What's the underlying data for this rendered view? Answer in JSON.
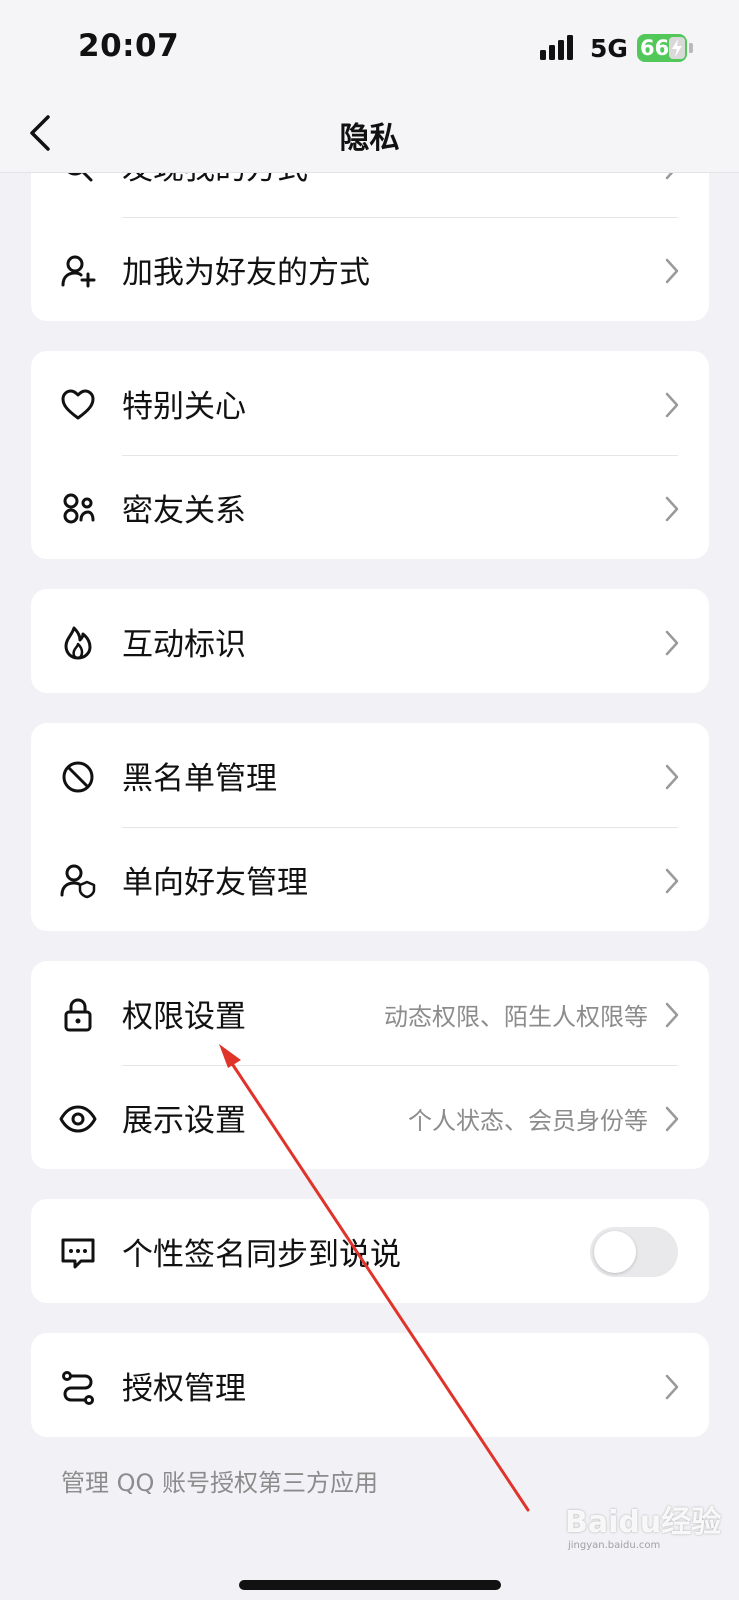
{
  "status_bar": {
    "time": "20:07",
    "network": "5G",
    "battery": "66"
  },
  "nav": {
    "title": "隐私"
  },
  "sections": {
    "discover": {
      "label": "发现我的方式"
    },
    "add_friend": {
      "label": "加我为好友的方式"
    },
    "special_care": {
      "label": "特别关心"
    },
    "close_friends": {
      "label": "密友关系"
    },
    "interaction": {
      "label": "互动标识"
    },
    "blacklist": {
      "label": "黑名单管理"
    },
    "one_way": {
      "label": "单向好友管理"
    },
    "permissions": {
      "label": "权限设置",
      "sub": "动态权限、陌生人权限等"
    },
    "display": {
      "label": "展示设置",
      "sub": "个人状态、会员身份等"
    },
    "signature_sync": {
      "label": "个性签名同步到说说",
      "enabled": false
    },
    "authorization": {
      "label": "授权管理"
    }
  },
  "footnote": "管理 QQ 账号授权第三方应用",
  "watermark": {
    "text": "Baidu经验",
    "sub": "jingyan.baidu.com"
  },
  "colors": {
    "background": "#f2f2f6",
    "card": "#ffffff",
    "secondary_text": "#8c8c8c",
    "battery": "#53c85a",
    "annotation_arrow": "#e0332a"
  }
}
